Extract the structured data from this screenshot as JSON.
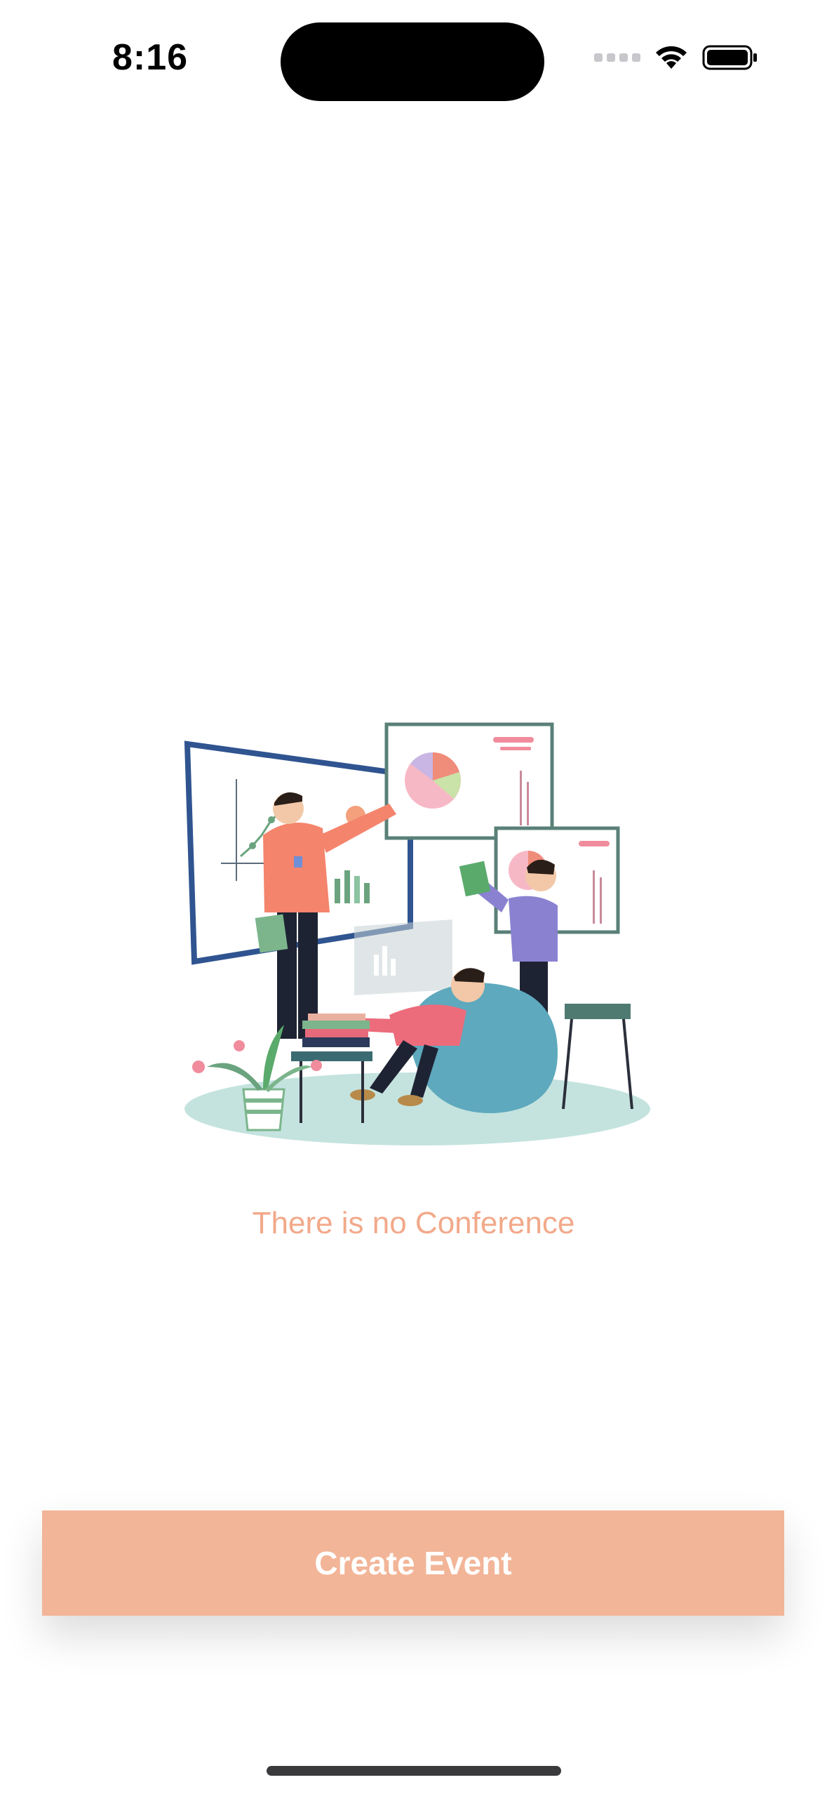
{
  "status_bar": {
    "time": "8:16",
    "icons": [
      "cellular-dots-icon",
      "wifi-icon",
      "battery-icon"
    ]
  },
  "empty_state": {
    "illustration": "conference-meeting-illustration",
    "message": "There is no Conference"
  },
  "primary_action": {
    "label": "Create Event"
  },
  "colors": {
    "accent": "#f2b598",
    "message_text": "#f2a98a",
    "background": "#ffffff"
  }
}
